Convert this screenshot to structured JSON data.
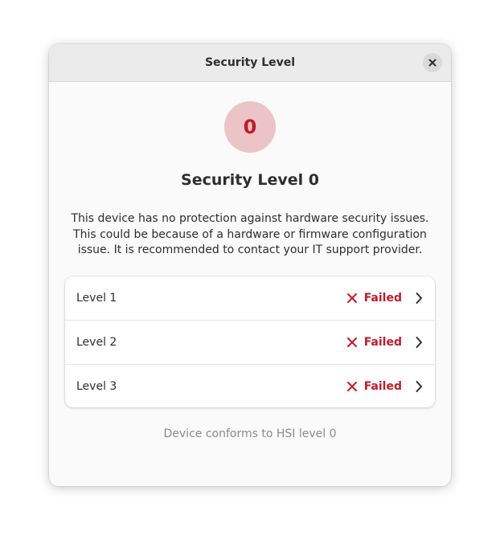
{
  "window": {
    "title": "Security Level",
    "close_icon": "close-icon"
  },
  "badge": {
    "value": "0",
    "color": "#c01c28",
    "background": "#ecc3c6"
  },
  "heading": "Security Level 0",
  "description": "This device has no protection against hardware security issues. This could be because of a hardware or firmware configuration issue. It is recommended to contact your IT support provider.",
  "levels": [
    {
      "label": "Level 1",
      "status": "Failed",
      "status_icon": "x-icon",
      "nav_icon": "chevron-right-icon"
    },
    {
      "label": "Level 2",
      "status": "Failed",
      "status_icon": "x-icon",
      "nav_icon": "chevron-right-icon"
    },
    {
      "label": "Level 3",
      "status": "Failed",
      "status_icon": "x-icon",
      "nav_icon": "chevron-right-icon"
    }
  ],
  "footer": "Device conforms to HSI level 0",
  "colors": {
    "failed": "#c01c28",
    "muted_text": "#8a8a8a"
  }
}
